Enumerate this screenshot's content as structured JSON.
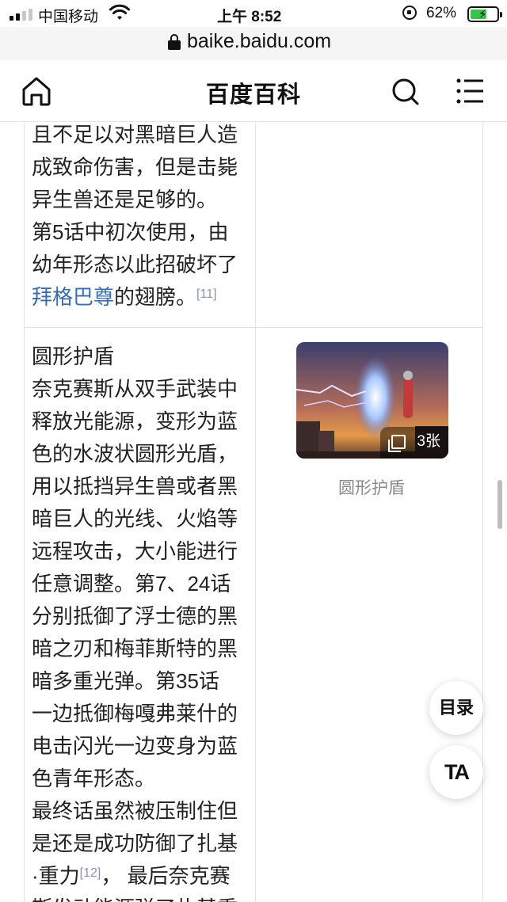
{
  "status_bar": {
    "carrier": "中国移动",
    "time": "上午 8:52",
    "battery_pct": "62%",
    "icons": [
      "signal-icon",
      "wifi-icon",
      "orientation-lock-icon",
      "battery-charging-icon"
    ]
  },
  "browser": {
    "url": "baike.baidu.com",
    "icons": [
      "padlock-icon"
    ]
  },
  "header": {
    "title": "百度百科",
    "icons": [
      "home-icon",
      "search-icon",
      "menu-icon"
    ]
  },
  "rows": [
    {
      "text_lines": [
        "且不足以对黑暗巨人造",
        "成致命伤害，但是击毙",
        "异生兽还是足够的。",
        "第5话中初次使用，由",
        "幼年形态以此招破坏了"
      ],
      "link": "拜格巴尊",
      "after_link": "的翅膀。",
      "ref": "[11]"
    },
    {
      "name": "圆形护盾",
      "description_lines": [
        "奈克赛斯从双手武装中",
        "释放光能源，变形为蓝",
        "色的水波状圆形光盾，",
        "用以抵挡异生兽或者黑",
        "暗巨人的光线、火焰等",
        "远程攻击，大小能进行",
        "任意调整。第7、24话",
        "分别抵御了浮士德的黑",
        "暗之刃和梅菲斯特的黑",
        "暗多重光弹。第35话",
        "一边抵御梅嘎弗莱什的",
        "电击闪光一边变身为蓝",
        "色青年形态。"
      ],
      "final_lines": [
        "最终话虽然被压制住但",
        "是还是成功防御了扎基"
      ],
      "final_line3": "·重力",
      "final_ref": "[12]",
      "final_line3_after": "，  最后奈克赛",
      "final_line4": "斯发动能源弹了扎基重",
      "image_count": "3张",
      "image_caption": "圆形护盾"
    }
  ],
  "floating": {
    "toc_label": "目录",
    "ta_label": "TA"
  }
}
